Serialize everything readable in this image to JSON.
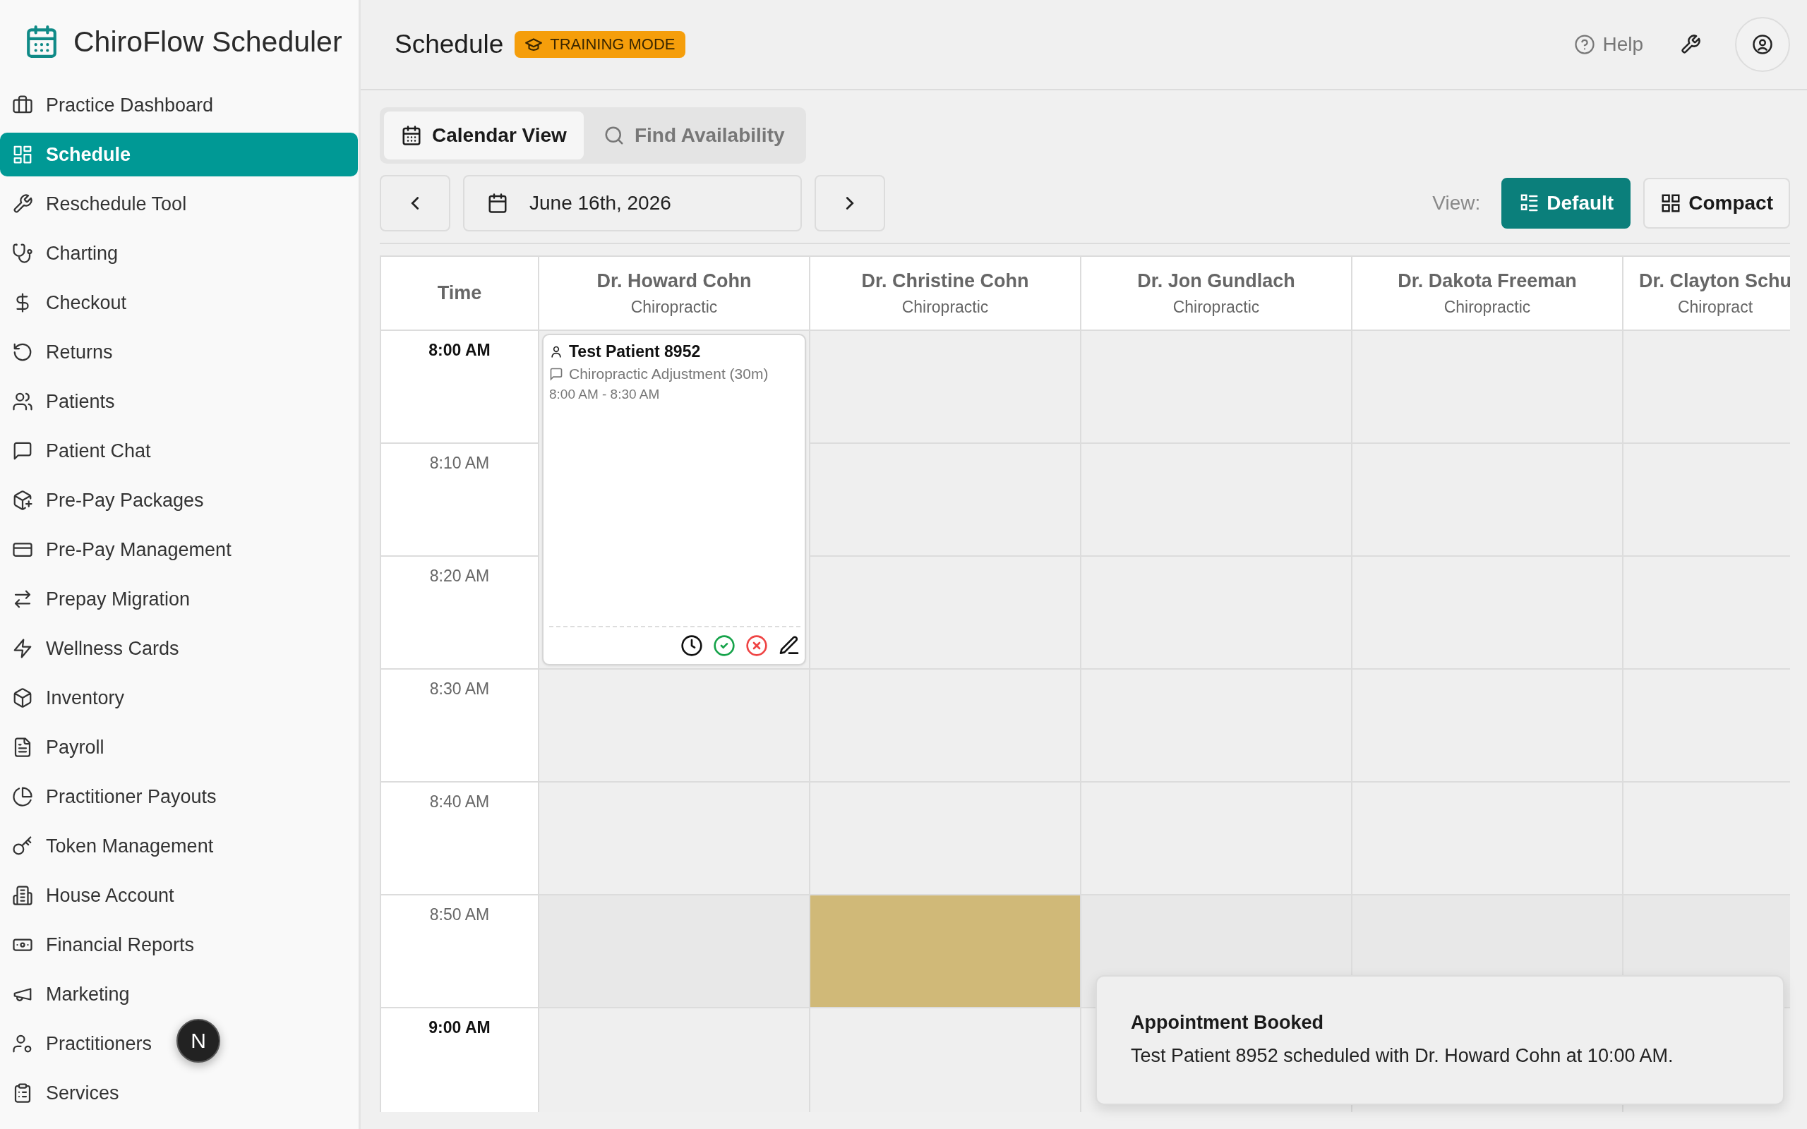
{
  "sidebar": {
    "title": "ChiroFlow Scheduler",
    "items": [
      {
        "label": "Practice Dashboard",
        "selected": false
      },
      {
        "label": "Schedule",
        "selected": true
      },
      {
        "label": "Reschedule Tool",
        "selected": false
      },
      {
        "label": "Charting",
        "selected": false
      },
      {
        "label": "Checkout",
        "selected": false
      },
      {
        "label": "Returns",
        "selected": false
      },
      {
        "label": "Patients",
        "selected": false
      },
      {
        "label": "Patient Chat",
        "selected": false
      },
      {
        "label": "Pre-Pay Packages",
        "selected": false
      },
      {
        "label": "Pre-Pay Management",
        "selected": false
      },
      {
        "label": "Prepay Migration",
        "selected": false
      },
      {
        "label": "Wellness Cards",
        "selected": false
      },
      {
        "label": "Inventory",
        "selected": false
      },
      {
        "label": "Payroll",
        "selected": false
      },
      {
        "label": "Practitioner Payouts",
        "selected": false
      },
      {
        "label": "Token Management",
        "selected": false
      },
      {
        "label": "House Account",
        "selected": false
      },
      {
        "label": "Financial Reports",
        "selected": false
      },
      {
        "label": "Marketing",
        "selected": false
      },
      {
        "label": "Practitioners",
        "selected": false
      },
      {
        "label": "Services",
        "selected": false
      }
    ]
  },
  "header": {
    "title": "Schedule",
    "badge": "TRAINING MODE",
    "help": "Help"
  },
  "tabs": [
    {
      "label": "Calendar View",
      "selected": true
    },
    {
      "label": "Find Availability",
      "selected": false
    }
  ],
  "date_nav": {
    "date": "June 16th, 2026"
  },
  "view_toggle": {
    "label": "View:",
    "options": [
      {
        "label": "Default",
        "selected": true
      },
      {
        "label": "Compact",
        "selected": false
      }
    ]
  },
  "schedule": {
    "time_header": "Time",
    "columns": [
      {
        "name": "Dr. Howard Cohn",
        "specialty": "Chiropractic"
      },
      {
        "name": "Dr. Christine Cohn",
        "specialty": "Chiropractic"
      },
      {
        "name": "Dr. Jon Gundlach",
        "specialty": "Chiropractic"
      },
      {
        "name": "Dr. Dakota Freeman",
        "specialty": "Chiropractic"
      },
      {
        "name": "Dr. Clayton Schu",
        "specialty": "Chiropract"
      }
    ],
    "rows": [
      {
        "time": "8:00 AM",
        "hour": true,
        "cells": [
          {
            "kind": "appointment",
            "patient": "Test Patient 8952",
            "service": "Chiropractic Adjustment (30m)",
            "time": "8:00 AM - 8:30 AM"
          },
          {
            "kind": "open"
          },
          {
            "kind": "open"
          },
          {
            "kind": "open"
          },
          {
            "kind": "open"
          }
        ]
      },
      {
        "time": "8:10 AM",
        "hour": false,
        "cells": [
          {
            "kind": "covered"
          },
          {
            "kind": "open"
          },
          {
            "kind": "open"
          },
          {
            "kind": "open"
          },
          {
            "kind": "open"
          }
        ]
      },
      {
        "time": "8:20 AM",
        "hour": false,
        "cells": [
          {
            "kind": "covered"
          },
          {
            "kind": "open"
          },
          {
            "kind": "open"
          },
          {
            "kind": "open"
          },
          {
            "kind": "open"
          }
        ]
      },
      {
        "time": "8:30 AM",
        "hour": false,
        "cells": [
          {
            "kind": "open"
          },
          {
            "kind": "open"
          },
          {
            "kind": "open"
          },
          {
            "kind": "open"
          },
          {
            "kind": "open"
          }
        ]
      },
      {
        "time": "8:40 AM",
        "hour": false,
        "cells": [
          {
            "kind": "open"
          },
          {
            "kind": "open"
          },
          {
            "kind": "open"
          },
          {
            "kind": "open"
          },
          {
            "kind": "open"
          }
        ]
      },
      {
        "time": "8:50 AM",
        "hour": false,
        "cells": [
          {
            "kind": "shaded"
          },
          {
            "kind": "highlight"
          },
          {
            "kind": "shaded"
          },
          {
            "kind": "shaded"
          },
          {
            "kind": "shaded"
          }
        ]
      },
      {
        "time": "9:00 AM",
        "hour": true,
        "cells": [
          {
            "kind": "open"
          },
          {
            "kind": "open"
          },
          {
            "kind": "open"
          },
          {
            "kind": "open"
          },
          {
            "kind": "open"
          }
        ]
      }
    ]
  },
  "toast": {
    "title": "Appointment Booked",
    "message": "Test Patient 8952 scheduled with Dr. Howard Cohn at 10:00 AM."
  },
  "dev_badge": "N"
}
